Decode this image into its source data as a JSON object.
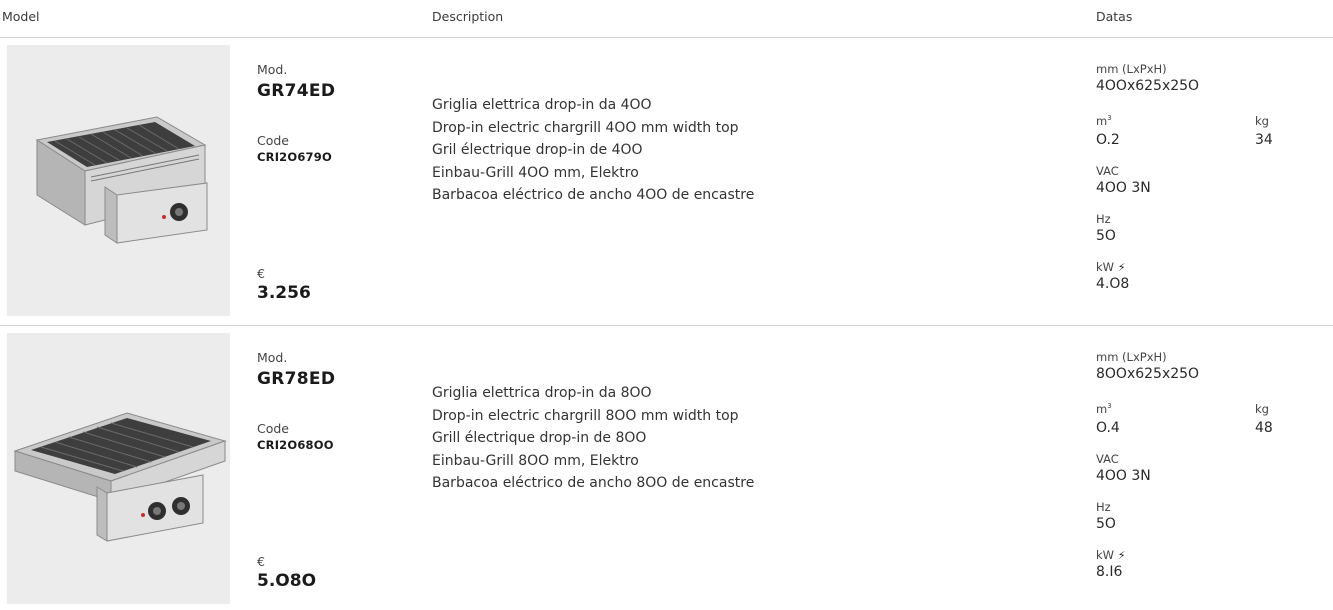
{
  "header": {
    "model": "Model",
    "description": "Description",
    "datas": "Datas"
  },
  "labels": {
    "mod": "Mod.",
    "code": "Code",
    "currency": "€",
    "dims": "mm (LxPxH)",
    "m3": "m",
    "m3_sup": "3",
    "kg": "kg",
    "vac": "VAC",
    "hz": "Hz",
    "kw": "kW",
    "kw_icon": "lightning-icon"
  },
  "products": [
    {
      "model": "GR74ED",
      "code": "CRI2O679O",
      "price": "3.256",
      "descriptions": [
        "Griglia elettrica drop-in da 4OO",
        "Drop-in electric chargrill 4OO mm width top",
        "Gril électrique drop-in de 4OO",
        "Einbau-Grill 4OO mm, Elektro",
        "Barbacoa eléctrico de ancho 4OO de encastre"
      ],
      "dims": "4OOx625x25O",
      "m3": "O.2",
      "kg": "34",
      "vac": "4OO 3N",
      "hz": "5O",
      "kw": "4.O8"
    },
    {
      "model": "GR78ED",
      "code": "CRI2O68OO",
      "price": "5.O8O",
      "descriptions": [
        "Griglia elettrica drop-in da 8OO",
        "Drop-in electric chargrill 8OO mm width top",
        "Grill électrique drop-in de 8OO",
        "Einbau-Grill 8OO mm, Elektro",
        "Barbacoa eléctrico de ancho 8OO de encastre"
      ],
      "dims": "8OOx625x25O",
      "m3": "O.4",
      "kg": "48",
      "vac": "4OO 3N",
      "hz": "5O",
      "kw": "8.I6"
    }
  ]
}
